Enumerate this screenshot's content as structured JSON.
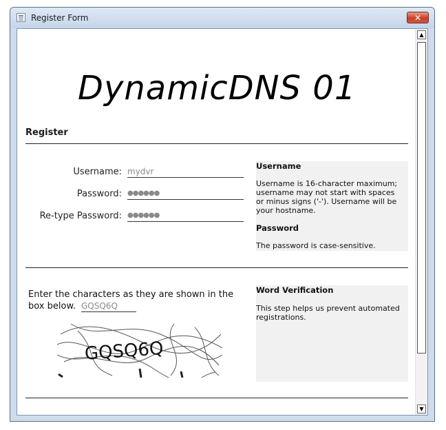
{
  "window": {
    "title": "Register Form",
    "close_glyph": "✕"
  },
  "logo": "DynamicDNS 01",
  "section": {
    "title": "Register"
  },
  "fields": {
    "username": {
      "label": "Username:",
      "value": "mydvr"
    },
    "password": {
      "label": "Password:",
      "value": "●●●●●●"
    },
    "retype": {
      "label": "Re-type Password:",
      "value": "●●●●●●"
    }
  },
  "help_register": {
    "username_title": "Username",
    "username_lines": [
      "Username is 16-character maximum;",
      "username may not start with spaces",
      "or minus signs ('-'). Username will be",
      "your hostname."
    ],
    "password_title": "Password",
    "password_text": "The password is case-sensitive."
  },
  "verification": {
    "instruction": "Enter the characters as they are shown in the box below.",
    "input_value": "GQSQ6Q",
    "captcha_text": "GQSQ6Q",
    "help_title": "Word Verification",
    "help_lines": [
      "This step helps us prevent automated",
      "registrations."
    ]
  },
  "scrollbar": {
    "up_glyph": "▲",
    "down_glyph": "▼"
  }
}
